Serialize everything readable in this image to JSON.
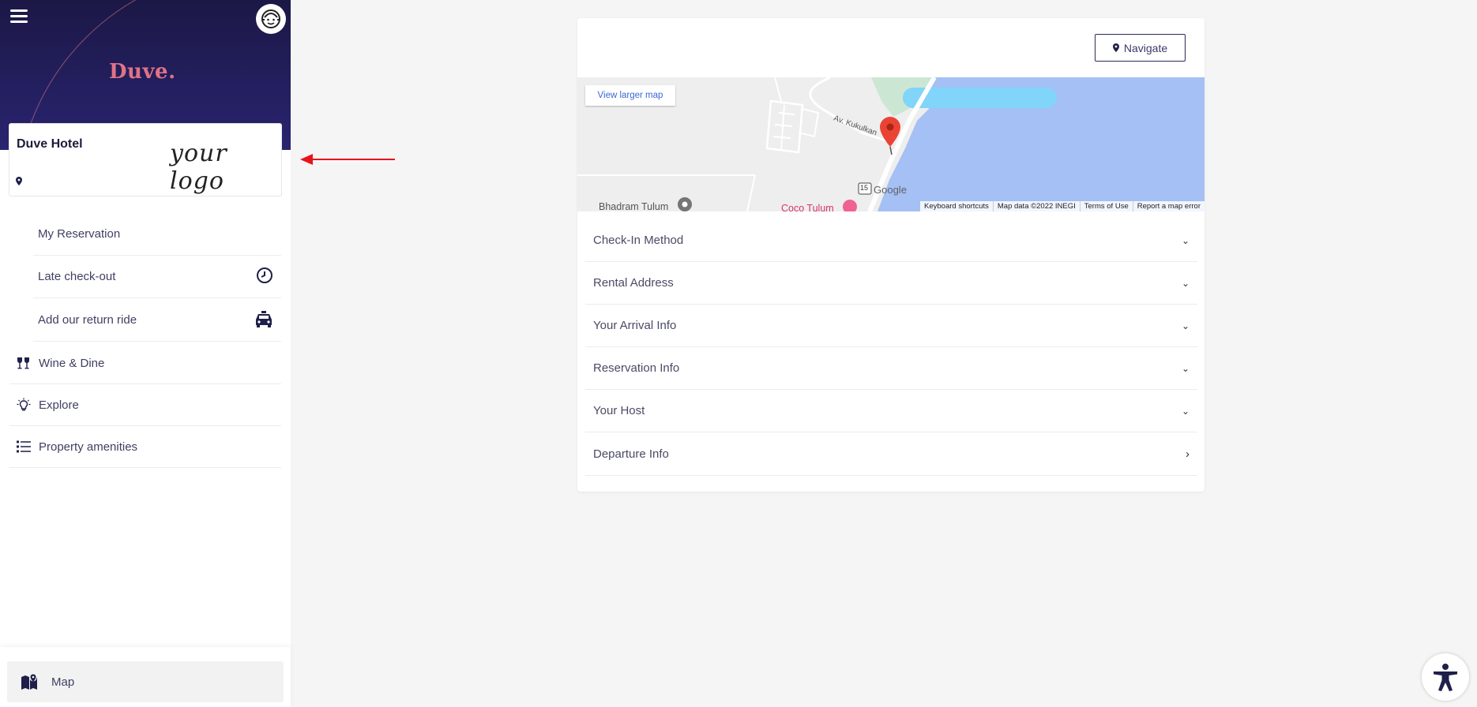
{
  "brand": {
    "name": "Duve."
  },
  "hotel": {
    "name": "Duve Hotel",
    "logo_text": "your logo"
  },
  "submenu": [
    {
      "label": "My Reservation",
      "icon": ""
    },
    {
      "label": "Late check-out",
      "icon": "clock-icon"
    },
    {
      "label": "Add our return ride",
      "icon": "taxi-icon"
    }
  ],
  "menu": [
    {
      "label": "Wine & Dine",
      "icon": "wine-glasses-icon"
    },
    {
      "label": "Explore",
      "icon": "lightbulb-icon"
    },
    {
      "label": "Property amenities",
      "icon": "list-icon"
    }
  ],
  "footer": {
    "map_label": "Map"
  },
  "card": {
    "navigate_label": "Navigate",
    "map": {
      "larger_map_label": "View larger map",
      "road_label": "Av. Kukulkan",
      "place_1": "Bhadram Tulum",
      "place_2": "Coco Tulum",
      "route_number": "15",
      "google_label": "Google",
      "footer_links": [
        "Keyboard shortcuts",
        "Map data ©2022 INEGI",
        "Terms of Use",
        "Report a map error"
      ]
    },
    "sections": [
      {
        "label": "Check-In Method",
        "state": "collapsed"
      },
      {
        "label": "Rental Address",
        "state": "collapsed"
      },
      {
        "label": "Your Arrival Info",
        "state": "collapsed"
      },
      {
        "label": "Reservation Info",
        "state": "collapsed"
      },
      {
        "label": "Your Host",
        "state": "collapsed"
      },
      {
        "label": "Departure Info",
        "state": "link"
      }
    ]
  },
  "colors": {
    "header_bg": "#1b1846",
    "brand_pink": "#e07386",
    "accent_navy": "#2a2a5a",
    "arrow_red": "#e8121a",
    "water_blue": "#a4c0f4"
  }
}
